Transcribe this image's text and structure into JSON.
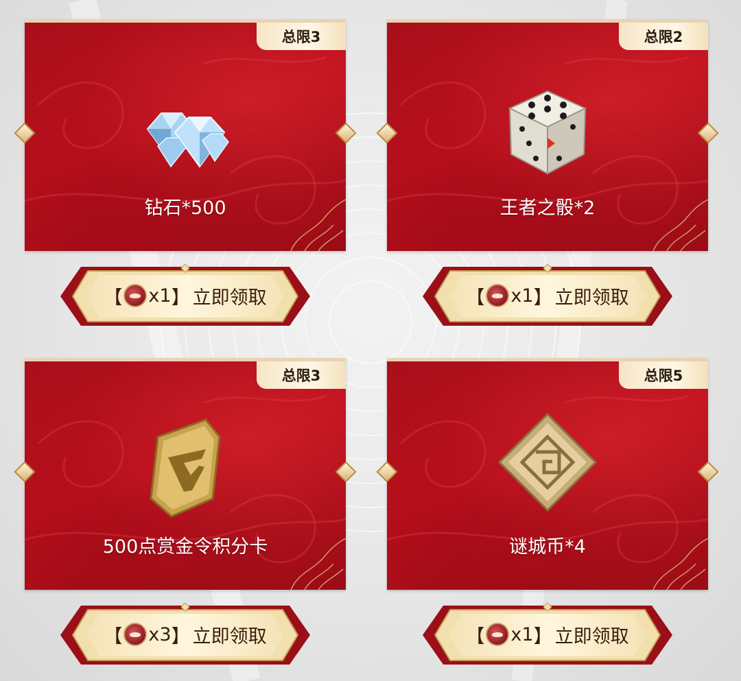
{
  "cards": [
    {
      "limit": "总限3",
      "item": "钻石*500",
      "icon": "diamond-icon",
      "button": {
        "open": "【",
        "count": "x1",
        "close": "】",
        "label": "立即领取"
      }
    },
    {
      "limit": "总限2",
      "item": "王者之骰*2",
      "icon": "dice-icon",
      "button": {
        "open": "【",
        "count": "x1",
        "close": "】",
        "label": "立即领取"
      }
    },
    {
      "limit": "总限3",
      "item": "500点赏金令积分卡",
      "icon": "shield-badge-icon",
      "button": {
        "open": "【",
        "count": "x3",
        "close": "】",
        "label": "立即领取"
      }
    },
    {
      "limit": "总限5",
      "item": "谜城币*4",
      "icon": "maze-coin-icon",
      "button": {
        "open": "【",
        "count": "x1",
        "close": "】",
        "label": "立即领取"
      }
    }
  ],
  "colors": {
    "card_red": "#b3111d",
    "gold": "#d9b77a",
    "badge_cream": "#fff7e6",
    "text_dark": "#3a1c10"
  }
}
